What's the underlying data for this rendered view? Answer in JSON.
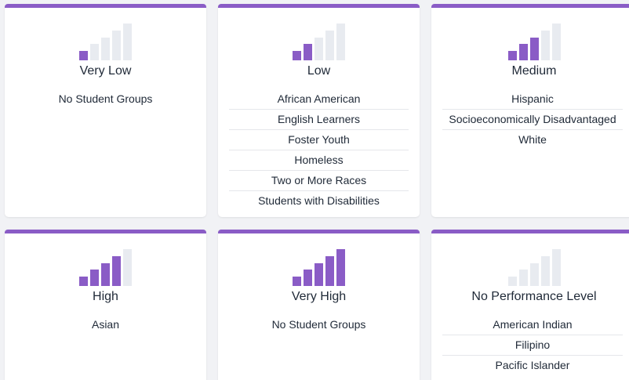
{
  "colors": {
    "accent": "#8a5cc6",
    "inactive_bar": "#e8ebf0"
  },
  "cards": [
    {
      "level": "Very Low",
      "filled_bars": 1,
      "groups": [
        "No Student Groups"
      ]
    },
    {
      "level": "Low",
      "filled_bars": 2,
      "groups": [
        "African American",
        "English Learners",
        "Foster Youth",
        "Homeless",
        "Two or More Races",
        "Students with Disabilities"
      ]
    },
    {
      "level": "Medium",
      "filled_bars": 3,
      "groups": [
        "Hispanic",
        "Socioeconomically Disadvantaged",
        "White"
      ]
    },
    {
      "level": "High",
      "filled_bars": 4,
      "groups": [
        "Asian"
      ]
    },
    {
      "level": "Very High",
      "filled_bars": 5,
      "groups": [
        "No Student Groups"
      ]
    },
    {
      "level": "No Performance Level",
      "filled_bars": 0,
      "groups": [
        "American Indian",
        "Filipino",
        "Pacific Islander"
      ]
    }
  ]
}
